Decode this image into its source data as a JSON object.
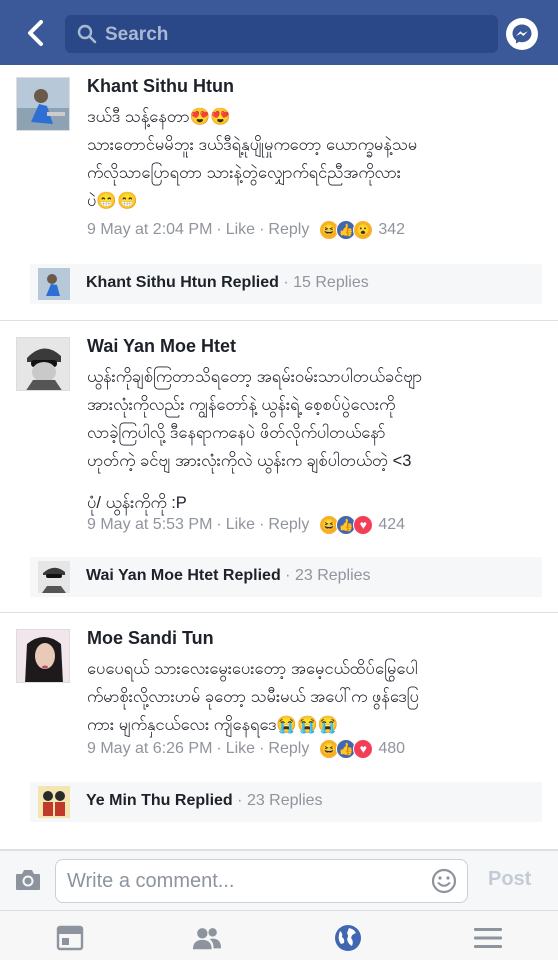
{
  "header": {
    "search_placeholder": "Search"
  },
  "comments": [
    {
      "author": "Khant Sithu Htun",
      "lines": [
        "ဒယ်ဒီ သန့်နေတာ😍😍",
        "သားတောင်မမိဘူး ဒယ်ဒီရဲ့နုပျိုမှုကတော့ ယောက္ခမနဲ့သမ",
        "က်လိုသာပြောရတာ သားနဲ့တွဲလျှောက်ရင်ညီအကိုလား",
        "ပဲ😁😁"
      ],
      "time": "9 May at 2:04 PM",
      "like": "Like",
      "reply": "Reply",
      "reactions": [
        "haha",
        "like",
        "wow"
      ],
      "reaction_count": "342",
      "replied_by": "Khant Sithu Htun",
      "replied_label": "Replied",
      "reply_count": "15 Replies"
    },
    {
      "author": "Wai Yan Moe Htet",
      "lines": [
        "ယွန်းကိုချစ်ကြတာသိရတော့ အရမ်းဝမ်းသာပါတယ်ခင်ဗျာ",
        "အားလုံးကိုလည်း ကျွန်တော်နဲ့ ယွန်းရဲ့ စေ့စပ်ပွဲလေးကို",
        "လာခဲ့ကြပါလို့ ဒီနေရာကနေပဲ ဖိတ်လိုက်ပါတယ်နော်",
        "ဟုတ်ကဲ့ ခင်ဗျ  အားလုံးကိုလဲ ယွန်းက ချစ်ပါတယ်တဲ့  <3",
        "ပုံ/ ယွန်းကိုကို :P"
      ],
      "time": "9 May at 5:53 PM",
      "like": "Like",
      "reply": "Reply",
      "reactions": [
        "haha",
        "like",
        "love"
      ],
      "reaction_count": "424",
      "replied_by": "Wai Yan Moe Htet",
      "replied_label": "Replied",
      "reply_count": "23 Replies"
    },
    {
      "author": "Moe Sandi Tun",
      "lines": [
        "ပေပေရယ် သားလေးမွေးပေးတော့ အမေ့ငယ်ထိပ်မြွေပေါ",
        "က်မာစိုးလို့လားဟမ် ခုတော့ သမီးမယ် အပေါ်က ဖွန်ဒေပြ",
        "ကား မျက်နှငယ်လေး ကျိနေရဒေ😭😭😭"
      ],
      "time": "9 May at 6:26 PM",
      "like": "Like",
      "reply": "Reply",
      "reactions": [
        "haha",
        "like",
        "love"
      ],
      "reaction_count": "480",
      "replied_by": "Ye Min Thu",
      "replied_label": "Replied",
      "reply_count": "23 Replies"
    }
  ],
  "composer": {
    "placeholder": "Write a comment...",
    "post_label": "Post"
  },
  "tabs": [
    "news-feed",
    "friends",
    "notifications",
    "menu"
  ],
  "colors": {
    "brand": "#3b5998",
    "like_blue": "#4267b2",
    "love_red": "#f33e58",
    "haha_yellow": "#f7b125",
    "active_tab": "#4267b2",
    "inactive_tab": "#8d949e"
  }
}
